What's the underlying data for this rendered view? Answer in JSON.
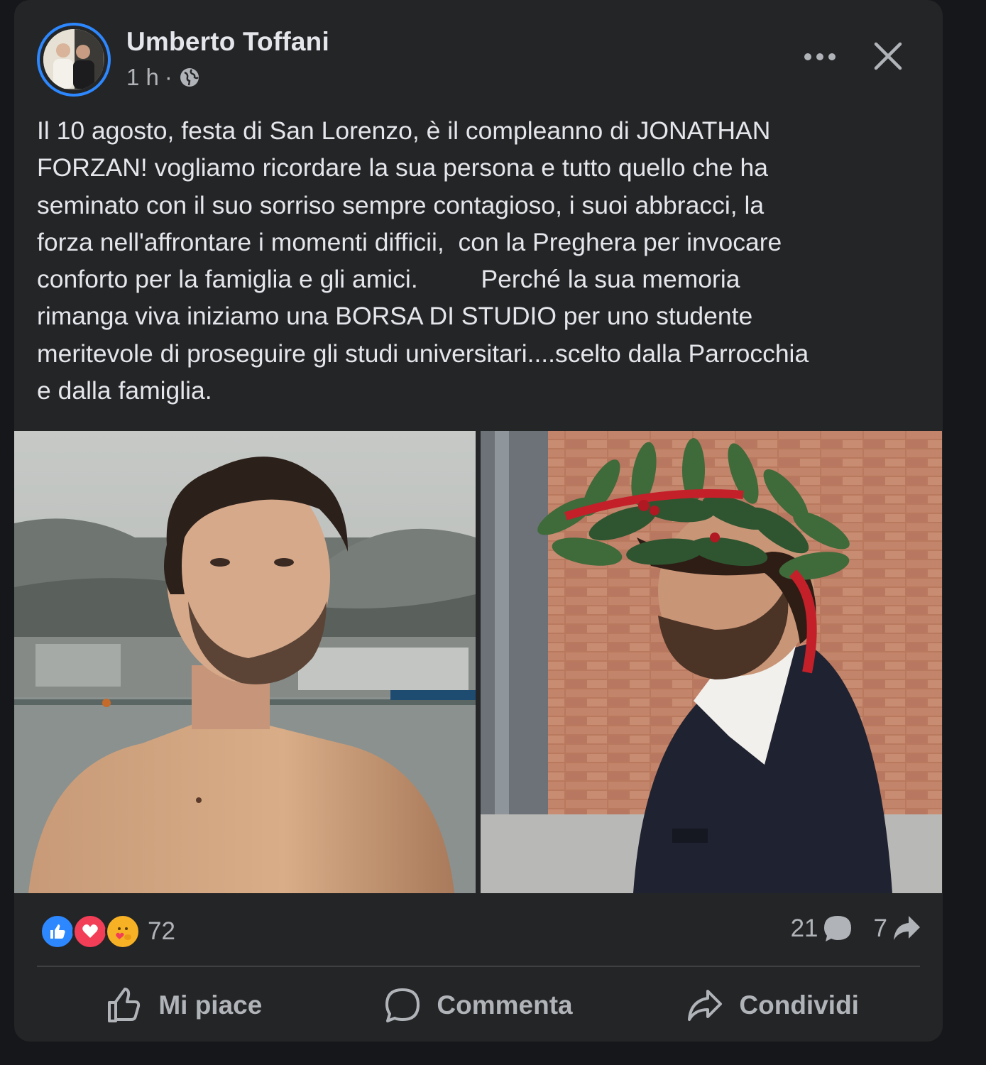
{
  "post": {
    "author": "Umberto Toffani",
    "time": "1 h",
    "separator": "·",
    "privacy_icon": "globe-icon",
    "text": "Il 10 agosto, festa di San Lorenzo, è il compleanno di JONATHAN\nFORZAN! vogliamo ricordare la sua persona e tutto quello che ha\nseminato con il suo sorriso sempre contagioso, i suoi abbracci, la\nforza nell'affrontare i momenti difficii,  con la Preghera per invocare\nconforto per la famiglia e gli amici.         Perché la sua memoria\nrimanga viva iniziamo una BORSA DI STUDIO per uno studente\nmeritevole di proseguire gli studi universitari....scelto dalla Parrocchia\ne dalla famiglia.",
    "photos": [
      "photo-man-seaside",
      "photo-graduate-laurel-wreath"
    ]
  },
  "header": {
    "more_icon": "more-options-icon",
    "close_icon": "close-icon"
  },
  "stats": {
    "reactions": [
      "like-reaction-icon",
      "love-reaction-icon",
      "care-reaction-icon"
    ],
    "reaction_count": "72",
    "comments": "21",
    "shares": "7"
  },
  "actions": {
    "like_label": "Mi piace",
    "comment_label": "Commenta",
    "share_label": "Condividi"
  },
  "colors": {
    "card_bg": "#242526",
    "text_primary": "#e4e6eb",
    "text_secondary": "#b0b3b8",
    "accent_blue": "#2d88ff",
    "love_red": "#f33e58",
    "care_yellow": "#f7b125"
  }
}
